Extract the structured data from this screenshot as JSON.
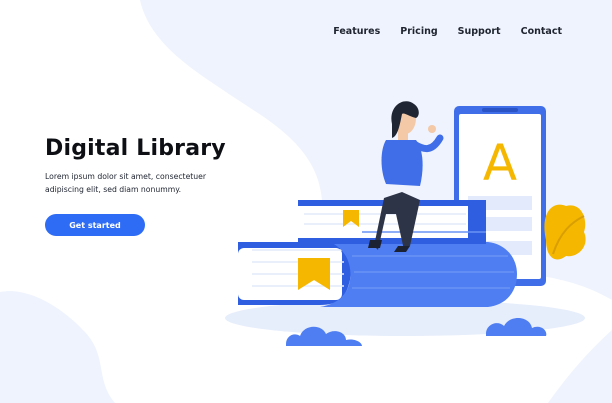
{
  "nav": {
    "items": [
      "Features",
      "Pricing",
      "Support",
      "Contact"
    ]
  },
  "hero": {
    "title": "Digital Library",
    "body": "Lorem ipsum dolor sit amet, consectetuer adipiscing elit, sed diam nonummy.",
    "cta_label": "Get started"
  },
  "illustration": {
    "tablet_letter": "A"
  },
  "colors": {
    "accent": "#2f6cf5",
    "book_blue": "#3f6ee8",
    "bookmark_yellow": "#f5b700",
    "background_blob": "#eef3fd"
  }
}
